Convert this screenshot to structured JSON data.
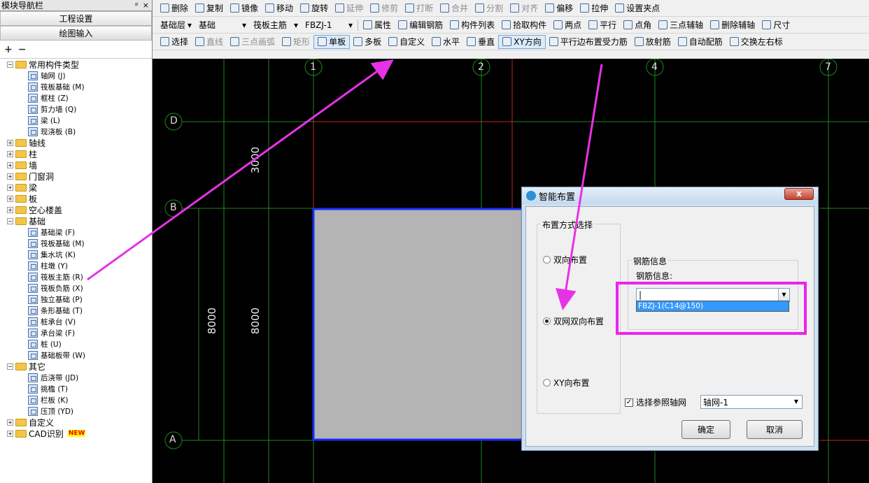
{
  "nav": {
    "title": "模块导航栏",
    "pin": "ᵖ",
    "close": "×",
    "tab_project": "工程设置",
    "tab_drawing": "绘图输入",
    "expand_all": "+",
    "collapse_all": "−",
    "tree": [
      {
        "label": "常用构件类型",
        "level": 0,
        "expanded": true
      },
      {
        "label": "轴网 (J)",
        "level": 1
      },
      {
        "label": "筏板基础 (M)",
        "level": 1
      },
      {
        "label": "框柱 (Z)",
        "level": 1
      },
      {
        "label": "剪力墙 (Q)",
        "level": 1
      },
      {
        "label": "梁 (L)",
        "level": 1
      },
      {
        "label": "现浇板 (B)",
        "level": 1
      },
      {
        "label": "轴线",
        "level": 0
      },
      {
        "label": "柱",
        "level": 0
      },
      {
        "label": "墙",
        "level": 0
      },
      {
        "label": "门窗洞",
        "level": 0
      },
      {
        "label": "梁",
        "level": 0
      },
      {
        "label": "板",
        "level": 0
      },
      {
        "label": "空心楼盖",
        "level": 0
      },
      {
        "label": "基础",
        "level": 0,
        "expanded": true
      },
      {
        "label": "基础梁 (F)",
        "level": 1
      },
      {
        "label": "筏板基础 (M)",
        "level": 1
      },
      {
        "label": "集水坑 (K)",
        "level": 1
      },
      {
        "label": "柱墩 (Y)",
        "level": 1
      },
      {
        "label": "筏板主筋 (R)",
        "level": 1
      },
      {
        "label": "筏板负筋 (X)",
        "level": 1
      },
      {
        "label": "独立基础 (P)",
        "level": 1
      },
      {
        "label": "条形基础 (T)",
        "level": 1
      },
      {
        "label": "桩承台 (V)",
        "level": 1
      },
      {
        "label": "承台梁 (F)",
        "level": 1
      },
      {
        "label": "桩 (U)",
        "level": 1
      },
      {
        "label": "基础板带 (W)",
        "level": 1
      },
      {
        "label": "其它",
        "level": 0,
        "expanded": true
      },
      {
        "label": "后浇带 (JD)",
        "level": 1
      },
      {
        "label": "挑檐 (T)",
        "level": 1
      },
      {
        "label": "栏板 (K)",
        "level": 1
      },
      {
        "label": "压顶 (YD)",
        "level": 1
      },
      {
        "label": "自定义",
        "level": 0
      },
      {
        "label": "CAD识别",
        "level": 0,
        "badge": "NEW"
      }
    ]
  },
  "toolbar1": [
    "删除",
    "复制",
    "镜像",
    "移动",
    "旋转",
    "延伸",
    "修剪",
    "打断",
    "合并",
    "分割",
    "对齐",
    "偏移",
    "拉伸",
    "设置夹点"
  ],
  "toolbar2": {
    "floor": "基础层",
    "category": "基础",
    "type": "筏板主筋",
    "component": "FBZJ-1",
    "items": [
      "属性",
      "编辑钢筋",
      "构件列表",
      "拾取构件",
      "两点",
      "平行",
      "点角",
      "三点辅轴",
      "删除辅轴",
      "尺寸"
    ]
  },
  "toolbar3": [
    "选择",
    "直线",
    "三点画弧",
    "矩形",
    "单板",
    "多板",
    "自定义",
    "水平",
    "垂直",
    "XY方向",
    "平行边布置受力筋",
    "放射筋",
    "自动配筋",
    "交换左右标"
  ],
  "grid": {
    "col_labels": [
      "1",
      "2",
      "4",
      "7"
    ],
    "row_labels": [
      "D",
      "B",
      "A"
    ],
    "dims": [
      "3000",
      "8000",
      "8000"
    ]
  },
  "dialog": {
    "title": "智能布置",
    "close": "x",
    "group_label": "布置方式选择",
    "opt_bidir": "双向布置",
    "opt_dual": "双网双向布置",
    "opt_xy": "XY向布置",
    "rebar_group": "钢筋信息",
    "rebar_label": "钢筋信息:",
    "rebar_value": "",
    "rebar_option": "FBZJ-1(C14@150)",
    "ref_check": "选择参照轴网",
    "ref_value": "轴网-1",
    "ok": "确定",
    "cancel": "取消"
  }
}
